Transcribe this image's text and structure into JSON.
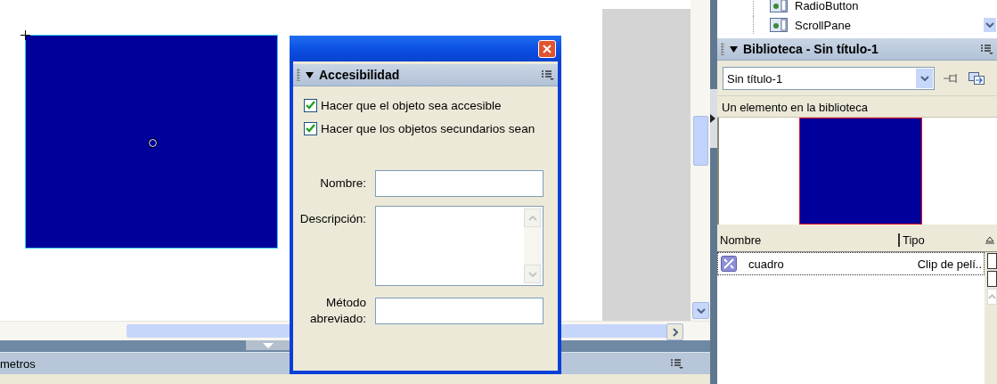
{
  "component_tree": [
    {
      "label": "RadioButton"
    },
    {
      "label": "ScrollPane"
    }
  ],
  "library_panel": {
    "title": "Biblioteca - Sin título-1",
    "expanded": true,
    "library_select": {
      "value": "Sin título-1"
    },
    "summary": "Un elemento en la biblioteca",
    "columns": [
      "Nombre",
      "Tipo"
    ],
    "items": [
      {
        "name": "cuadro",
        "type": "Clip de pelí..",
        "selected": true
      }
    ]
  },
  "parameters_panel": {
    "title": "metros"
  },
  "accessibility_dialog": {
    "title": "Accesibilidad",
    "expanded": true,
    "checkboxes": [
      {
        "label": "Hacer que el objeto sea accesible",
        "checked": true
      },
      {
        "label": "Hacer que los objetos secundarios sean",
        "checked": true
      }
    ],
    "fields": [
      {
        "label": "Nombre:",
        "kind": "text"
      },
      {
        "label": "Descripción:",
        "kind": "textarea"
      },
      {
        "label": "Método abreviado:",
        "kind": "text"
      }
    ]
  }
}
